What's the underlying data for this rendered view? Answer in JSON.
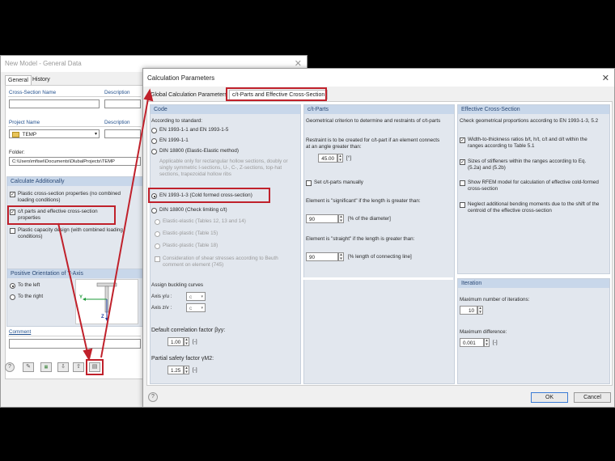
{
  "bg_window": {
    "title": "New Model - General Data",
    "tabs": [
      "General",
      "History"
    ],
    "cross_section_name_label": "Cross-Section Name",
    "description_label": "Description",
    "project_name_label": "Project Name",
    "project_description_label": "Description",
    "project_value": "TEMP",
    "folder_label": "Folder:",
    "folder_value": "C:\\Users\\mfisei\\Documents\\DlubalProjects\\TEMP",
    "calc_add": {
      "header": "Calculate Additionally",
      "plastic": "Plastic cross-section properties (no combined loading conditions)",
      "ct_parts": "c/t parts and effective cross-section properties",
      "plastic_capacity": "Plastic capacity design (with combined loading conditions)"
    },
    "orientation": {
      "header": "Positive Orientation of Y-Axis",
      "left": "To the left",
      "right": "To the right",
      "axis_y": "Y",
      "axis_z": "Z"
    },
    "comment_label": "Comment"
  },
  "dialog": {
    "title": "Calculation Parameters",
    "tabs": [
      "Global Calculation Parameters",
      "c/t-Parts and Effective Cross-Section"
    ],
    "code": {
      "header": "Code",
      "according": "According to standard:",
      "opt1": "EN 1993-1-1 and EN 1993-1-5",
      "opt2": "EN 1999-1-1",
      "opt3": "DIN 18800 (Elastic-Elastic method)",
      "note": "Applicable only for rectangular hollow sections, doubly or singly symmetric I-sections, U-, C-, Z-sections, top-hat sections, trapezoidal hollow ribs",
      "opt4": "EN 1993-1-3 (Cold formed cross-section)",
      "opt5": "DIN 18800 (Check limiting c/t)",
      "sub1": "Elastic-elastic (Tables 12, 13 and 14)",
      "sub2": "Elastic-plastic (Table 15)",
      "sub3": "Plastic-plastic (Table 18)",
      "shear": "Consideration of shear stresses according to Beuth comment on element (745)",
      "buckling_header": "Assign buckling curves",
      "axis_yu": "Axis y/u :",
      "axis_zv": "Axis z/v :",
      "axis_yu_value": "c",
      "axis_zv_value": "c",
      "corr_label": "Default correlation factor βyy:",
      "corr_value": "1.00",
      "corr_unit": "[-]",
      "psf_label": "Partial safety factor γM2:",
      "psf_value": "1.25",
      "psf_unit": "[-]"
    },
    "ctparts": {
      "header": "c/t-Parts",
      "desc": "Geometrical criterion to determine and restraints of c/t-parts",
      "restraint": "Restraint is to be created for c/t-part if an element connects at an angle greater than:",
      "angle_value": "45.00",
      "angle_unit": "[°]",
      "manual": "Set c/t-parts manually",
      "significant": "Element is \"significant\" if the length is greater than:",
      "sig_value": "90",
      "sig_unit": "[% of the diameter]",
      "straight": "Element is \"straight\" if the length is greater than:",
      "str_value": "90",
      "str_unit": "[% length of connecting line]"
    },
    "effective": {
      "header": "Effective Cross-Section",
      "desc": "Check geometrical proportions according to EN 1993-1-3, 5.2",
      "chk1": "Width-to-thickness ratios b/t, h/t, c/t and d/t within the ranges according to Table 5.1",
      "chk2": "Sizes of stiffeners within the ranges according to Eq. (5.2a) and (5.2b)",
      "chk3": "Show RFEM model for calculation of effective cold-formed cross-section",
      "chk4": "Neglect additional bending moments due to the shift of the centroid of the effective cross-section"
    },
    "iteration": {
      "header": "Iteration",
      "max_iter_label": "Maximum number of iterations:",
      "max_iter_value": "10",
      "max_diff_label": "Maximum difference:",
      "max_diff_value": "0.001",
      "max_diff_unit": "[-]"
    },
    "ok": "OK",
    "cancel": "Cancel"
  },
  "colors": {
    "highlight": "#c0212b",
    "group_header": "#c8d7ea",
    "group_bg": "#e2e7ee"
  }
}
